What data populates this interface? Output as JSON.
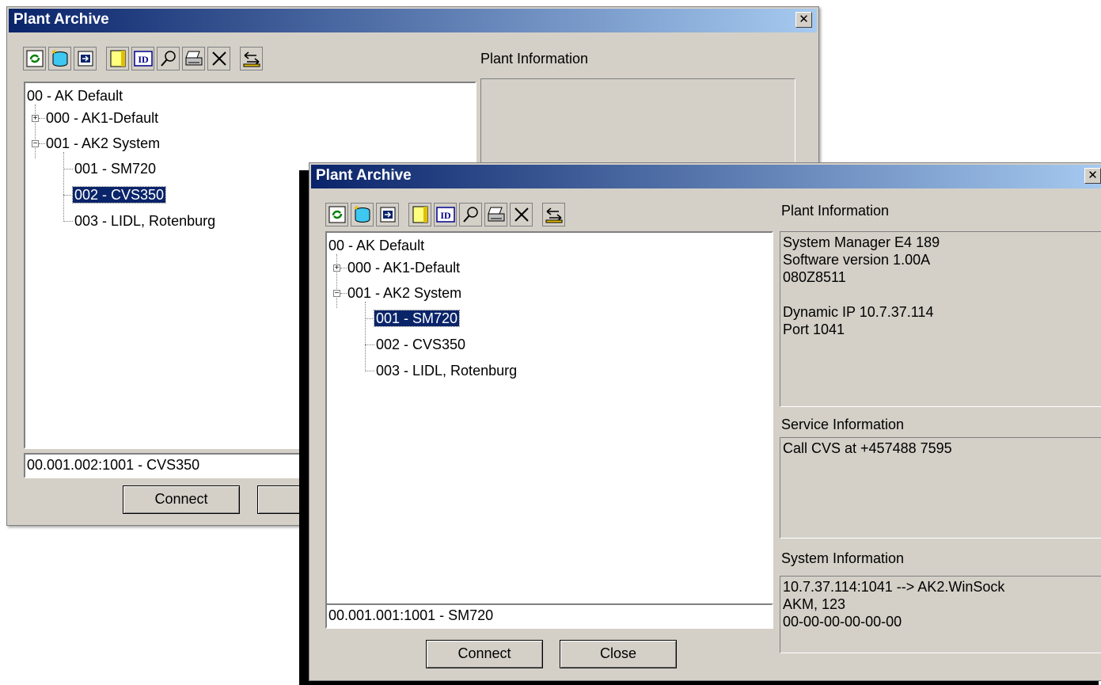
{
  "back_window": {
    "title": "Plant Archive",
    "plant_info_label": "Plant Information",
    "tree": {
      "root": "00 - AK Default",
      "group1": "000 - AK1-Default",
      "group2": "001 - AK2 System",
      "items": [
        "001 - SM720",
        "002 - CVS350",
        "003 - LIDL, Rotenburg"
      ],
      "selected_index": 1
    },
    "path": "00.001.002:1001 - CVS350",
    "connect_label": "Connect"
  },
  "front_window": {
    "title": "Plant Archive",
    "plant_info_label": "Plant Information",
    "plant_info_text": "System Manager E4 189\nSoftware version 1.00A\n080Z8511\n\nDynamic IP 10.7.37.114\nPort 1041",
    "service_info_label": "Service Information",
    "service_info_text": "Call CVS at +457488 7595",
    "system_info_label": "System Information",
    "system_info_text": "10.7.37.114:1041 --> AK2.WinSock\nAKM, 123\n00-00-00-00-00-00",
    "tree": {
      "root": "00 - AK Default",
      "group1": "000 - AK1-Default",
      "group2": "001 - AK2 System",
      "items": [
        "001 - SM720",
        "002 - CVS350",
        "003 - LIDL, Rotenburg"
      ],
      "selected_index": 0
    },
    "path": "00.001.001:1001 - SM720",
    "connect_label": "Connect",
    "close_label": "Close"
  },
  "toolbar_icons": [
    "refresh-icon",
    "database-icon",
    "import-icon",
    "note-icon",
    "id-icon",
    "search-icon",
    "print-icon",
    "delete-icon",
    "transfer-icon"
  ]
}
